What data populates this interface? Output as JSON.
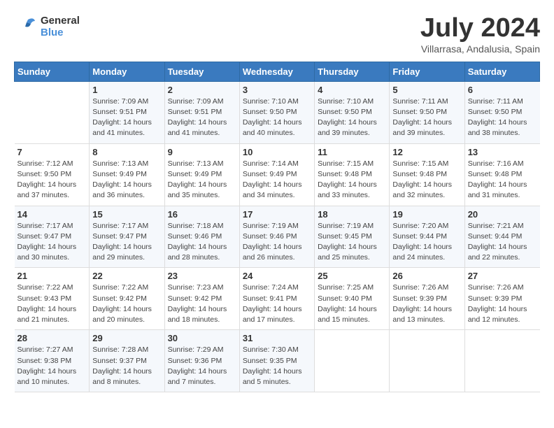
{
  "header": {
    "logo_line1": "General",
    "logo_line2": "Blue",
    "month": "July 2024",
    "location": "Villarrasa, Andalusia, Spain"
  },
  "weekdays": [
    "Sunday",
    "Monday",
    "Tuesday",
    "Wednesday",
    "Thursday",
    "Friday",
    "Saturday"
  ],
  "weeks": [
    [
      {
        "day": "",
        "info": ""
      },
      {
        "day": "1",
        "info": "Sunrise: 7:09 AM\nSunset: 9:51 PM\nDaylight: 14 hours\nand 41 minutes."
      },
      {
        "day": "2",
        "info": "Sunrise: 7:09 AM\nSunset: 9:51 PM\nDaylight: 14 hours\nand 41 minutes."
      },
      {
        "day": "3",
        "info": "Sunrise: 7:10 AM\nSunset: 9:50 PM\nDaylight: 14 hours\nand 40 minutes."
      },
      {
        "day": "4",
        "info": "Sunrise: 7:10 AM\nSunset: 9:50 PM\nDaylight: 14 hours\nand 39 minutes."
      },
      {
        "day": "5",
        "info": "Sunrise: 7:11 AM\nSunset: 9:50 PM\nDaylight: 14 hours\nand 39 minutes."
      },
      {
        "day": "6",
        "info": "Sunrise: 7:11 AM\nSunset: 9:50 PM\nDaylight: 14 hours\nand 38 minutes."
      }
    ],
    [
      {
        "day": "7",
        "info": "Sunrise: 7:12 AM\nSunset: 9:50 PM\nDaylight: 14 hours\nand 37 minutes."
      },
      {
        "day": "8",
        "info": "Sunrise: 7:13 AM\nSunset: 9:49 PM\nDaylight: 14 hours\nand 36 minutes."
      },
      {
        "day": "9",
        "info": "Sunrise: 7:13 AM\nSunset: 9:49 PM\nDaylight: 14 hours\nand 35 minutes."
      },
      {
        "day": "10",
        "info": "Sunrise: 7:14 AM\nSunset: 9:49 PM\nDaylight: 14 hours\nand 34 minutes."
      },
      {
        "day": "11",
        "info": "Sunrise: 7:15 AM\nSunset: 9:48 PM\nDaylight: 14 hours\nand 33 minutes."
      },
      {
        "day": "12",
        "info": "Sunrise: 7:15 AM\nSunset: 9:48 PM\nDaylight: 14 hours\nand 32 minutes."
      },
      {
        "day": "13",
        "info": "Sunrise: 7:16 AM\nSunset: 9:48 PM\nDaylight: 14 hours\nand 31 minutes."
      }
    ],
    [
      {
        "day": "14",
        "info": "Sunrise: 7:17 AM\nSunset: 9:47 PM\nDaylight: 14 hours\nand 30 minutes."
      },
      {
        "day": "15",
        "info": "Sunrise: 7:17 AM\nSunset: 9:47 PM\nDaylight: 14 hours\nand 29 minutes."
      },
      {
        "day": "16",
        "info": "Sunrise: 7:18 AM\nSunset: 9:46 PM\nDaylight: 14 hours\nand 28 minutes."
      },
      {
        "day": "17",
        "info": "Sunrise: 7:19 AM\nSunset: 9:46 PM\nDaylight: 14 hours\nand 26 minutes."
      },
      {
        "day": "18",
        "info": "Sunrise: 7:19 AM\nSunset: 9:45 PM\nDaylight: 14 hours\nand 25 minutes."
      },
      {
        "day": "19",
        "info": "Sunrise: 7:20 AM\nSunset: 9:44 PM\nDaylight: 14 hours\nand 24 minutes."
      },
      {
        "day": "20",
        "info": "Sunrise: 7:21 AM\nSunset: 9:44 PM\nDaylight: 14 hours\nand 22 minutes."
      }
    ],
    [
      {
        "day": "21",
        "info": "Sunrise: 7:22 AM\nSunset: 9:43 PM\nDaylight: 14 hours\nand 21 minutes."
      },
      {
        "day": "22",
        "info": "Sunrise: 7:22 AM\nSunset: 9:42 PM\nDaylight: 14 hours\nand 20 minutes."
      },
      {
        "day": "23",
        "info": "Sunrise: 7:23 AM\nSunset: 9:42 PM\nDaylight: 14 hours\nand 18 minutes."
      },
      {
        "day": "24",
        "info": "Sunrise: 7:24 AM\nSunset: 9:41 PM\nDaylight: 14 hours\nand 17 minutes."
      },
      {
        "day": "25",
        "info": "Sunrise: 7:25 AM\nSunset: 9:40 PM\nDaylight: 14 hours\nand 15 minutes."
      },
      {
        "day": "26",
        "info": "Sunrise: 7:26 AM\nSunset: 9:39 PM\nDaylight: 14 hours\nand 13 minutes."
      },
      {
        "day": "27",
        "info": "Sunrise: 7:26 AM\nSunset: 9:39 PM\nDaylight: 14 hours\nand 12 minutes."
      }
    ],
    [
      {
        "day": "28",
        "info": "Sunrise: 7:27 AM\nSunset: 9:38 PM\nDaylight: 14 hours\nand 10 minutes."
      },
      {
        "day": "29",
        "info": "Sunrise: 7:28 AM\nSunset: 9:37 PM\nDaylight: 14 hours\nand 8 minutes."
      },
      {
        "day": "30",
        "info": "Sunrise: 7:29 AM\nSunset: 9:36 PM\nDaylight: 14 hours\nand 7 minutes."
      },
      {
        "day": "31",
        "info": "Sunrise: 7:30 AM\nSunset: 9:35 PM\nDaylight: 14 hours\nand 5 minutes."
      },
      {
        "day": "",
        "info": ""
      },
      {
        "day": "",
        "info": ""
      },
      {
        "day": "",
        "info": ""
      }
    ]
  ]
}
